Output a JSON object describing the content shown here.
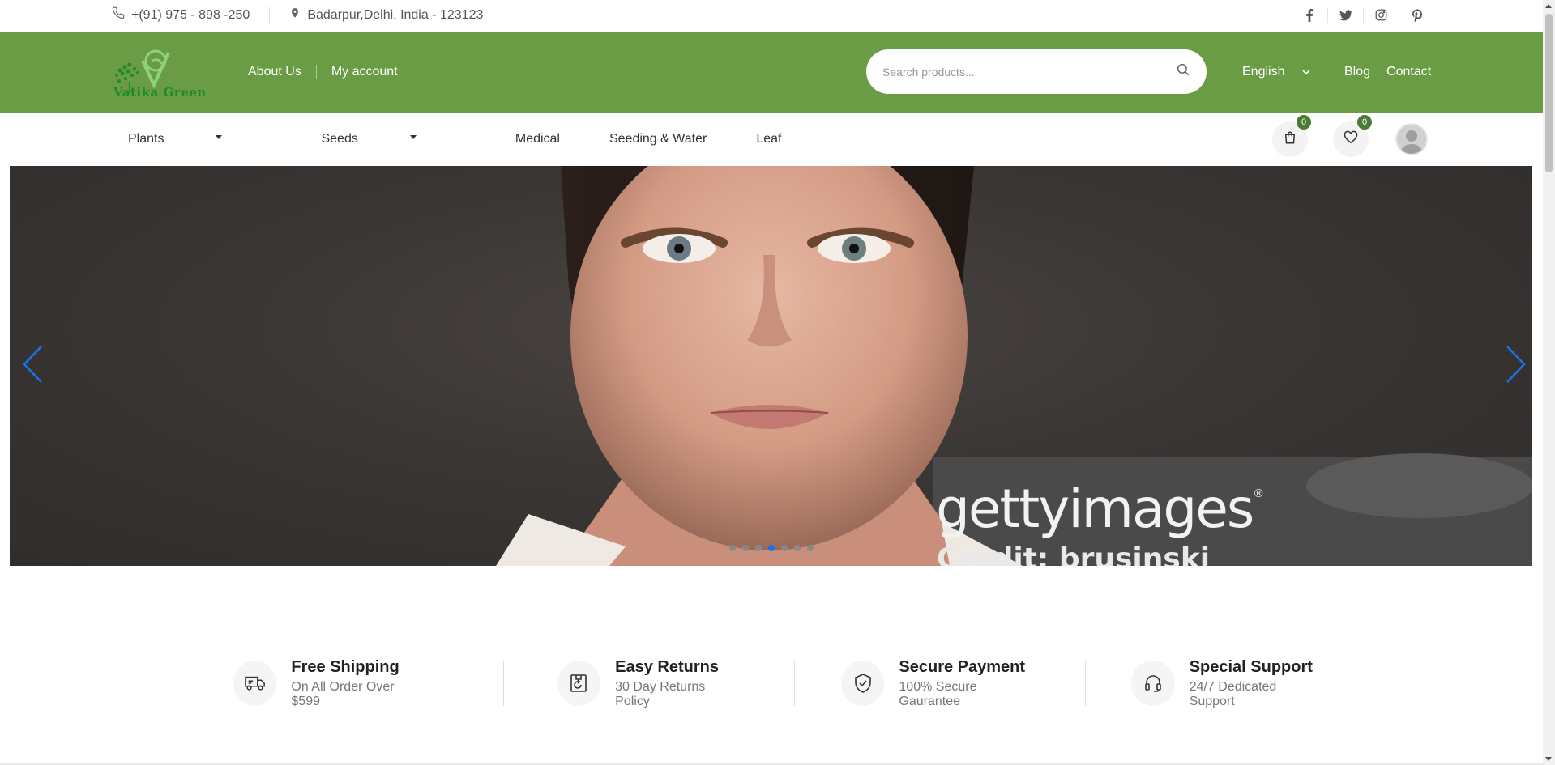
{
  "topbar": {
    "phone": "+(91) 975 - 898 -250",
    "address": "Badarpur,Delhi, India - 123123",
    "social": [
      "facebook-icon",
      "twitter-icon",
      "instagram-icon",
      "pinterest-icon"
    ]
  },
  "header": {
    "logo_text": "Vatika Green",
    "nav": [
      "About Us",
      "My account"
    ],
    "search_placeholder": "Search products...",
    "language": "English",
    "links": [
      "Blog",
      "Contact"
    ],
    "bg_color": "#6a9b45"
  },
  "catnav": {
    "items": [
      {
        "label": "Plants",
        "dropdown": true
      },
      {
        "label": "Seeds",
        "dropdown": true
      },
      {
        "label": "Medical",
        "dropdown": false
      },
      {
        "label": "Seeding & Water",
        "dropdown": false
      },
      {
        "label": "Leaf",
        "dropdown": false
      }
    ],
    "cart_count": "0",
    "wishlist_count": "0"
  },
  "hero": {
    "watermark": "gettyimages",
    "credit": "Credit: brusinski",
    "slides": 7,
    "active_slide": 4
  },
  "features": [
    {
      "title": "Free Shipping",
      "subtitle": "On All Order Over $599",
      "icon": "truck-icon"
    },
    {
      "title": "Easy Returns",
      "subtitle": "30 Day Returns Policy",
      "icon": "return-box-icon"
    },
    {
      "title": "Secure Payment",
      "subtitle": "100% Secure Gaurantee",
      "icon": "shield-check-icon"
    },
    {
      "title": "Special Support",
      "subtitle": "24/7 Dedicated Support",
      "icon": "headset-icon"
    }
  ]
}
